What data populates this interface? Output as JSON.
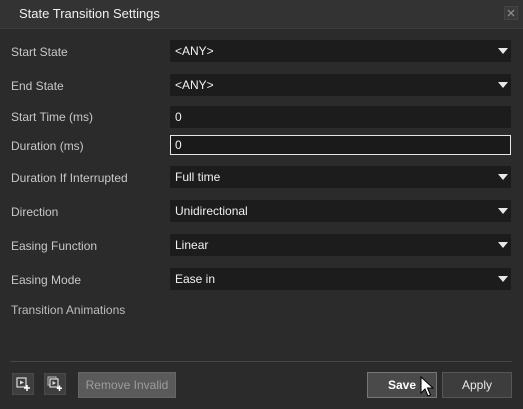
{
  "dialog": {
    "title": "State Transition Settings"
  },
  "fields": {
    "start_state": {
      "label": "Start State",
      "value": "<ANY>"
    },
    "end_state": {
      "label": "End State",
      "value": "<ANY>"
    },
    "start_time": {
      "label": "Start Time (ms)",
      "value": "0"
    },
    "duration": {
      "label": "Duration (ms)",
      "value": "0"
    },
    "duration_if_interrupted": {
      "label": "Duration If Interrupted",
      "value": "Full time"
    },
    "direction": {
      "label": "Direction",
      "value": "Unidirectional"
    },
    "easing_function": {
      "label": "Easing Function",
      "value": "Linear"
    },
    "easing_mode": {
      "label": "Easing Mode",
      "value": "Ease in"
    }
  },
  "section": {
    "transition_animations": "Transition Animations"
  },
  "footer": {
    "remove_invalid_label": "Remove Invalid",
    "save_label": "Save",
    "apply_label": "Apply"
  },
  "icons": {
    "close": "close-icon",
    "add_animation": "add-animation-icon",
    "add_group": "add-group-icon",
    "cursor": "mouse-pointer-icon"
  }
}
